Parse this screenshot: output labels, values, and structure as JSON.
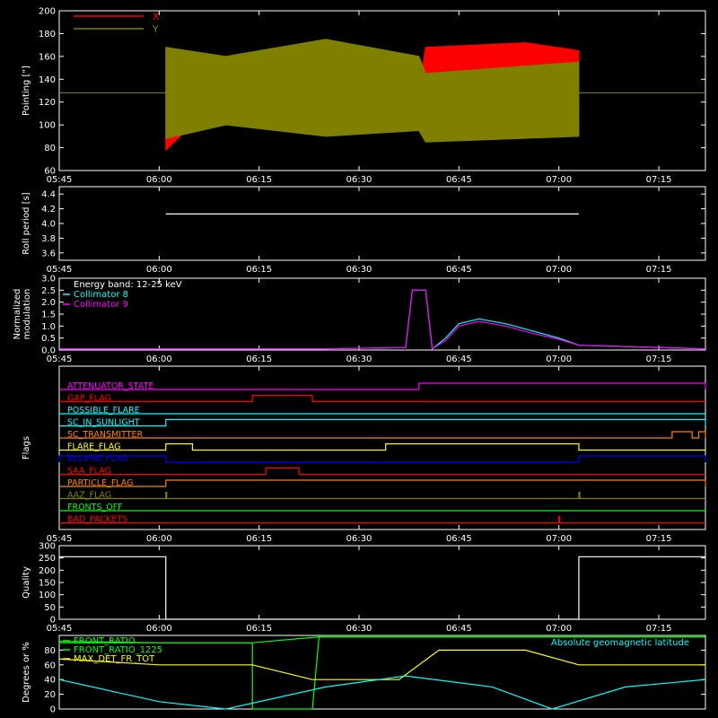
{
  "chart_data": [
    {
      "type": "line",
      "ylabel": "Pointing [\"]",
      "xlim": [
        "05:45",
        "07:22"
      ],
      "ylim": [
        60,
        200
      ],
      "yticks": [
        60,
        80,
        100,
        120,
        140,
        160,
        180,
        200
      ],
      "xticks": [
        "05:45",
        "06:00",
        "06:15",
        "06:30",
        "06:45",
        "07:00",
        "07:15"
      ],
      "legend_position": "top-left",
      "series": [
        {
          "name": "X",
          "color": "#ff0000",
          "envelope": [
            {
              "t": "06:01",
              "low": 78,
              "high": 165
            },
            {
              "t": "06:05",
              "low": 100,
              "high": 150
            },
            {
              "t": "06:15",
              "low": 120,
              "high": 140
            },
            {
              "t": "06:25",
              "low": 125,
              "high": 135
            },
            {
              "t": "06:39",
              "low": 128,
              "high": 132
            },
            {
              "t": "06:40",
              "low": 118,
              "high": 168
            },
            {
              "t": "06:55",
              "low": 112,
              "high": 172
            },
            {
              "t": "07:03",
              "low": 118,
              "high": 165
            }
          ]
        },
        {
          "name": "Y",
          "color": "#808000",
          "baseline": 128,
          "envelope": [
            {
              "t": "06:01",
              "low": 88,
              "high": 168
            },
            {
              "t": "06:10",
              "low": 100,
              "high": 160
            },
            {
              "t": "06:25",
              "low": 90,
              "high": 175
            },
            {
              "t": "06:39",
              "low": 95,
              "high": 160
            },
            {
              "t": "06:40",
              "low": 85,
              "high": 145
            },
            {
              "t": "07:03",
              "low": 90,
              "high": 155
            }
          ]
        }
      ]
    },
    {
      "type": "line",
      "ylabel": "Roll period [s]",
      "xlim": [
        "05:45",
        "07:22"
      ],
      "ylim": [
        3.5,
        4.5
      ],
      "yticks": [
        3.6,
        3.8,
        4.0,
        4.2,
        4.4
      ],
      "xticks": [
        "05:45",
        "06:00",
        "06:15",
        "06:30",
        "06:45",
        "07:00",
        "07:15"
      ],
      "series": [
        {
          "name": "",
          "color": "#ffffff",
          "points": [
            [
              "06:01",
              4.13
            ],
            [
              "07:03",
              4.13
            ]
          ]
        }
      ]
    },
    {
      "type": "line",
      "ylabel": "Normalized modulation",
      "xlim": [
        "05:45",
        "07:22"
      ],
      "ylim": [
        0,
        3
      ],
      "yticks": [
        0.0,
        0.5,
        1.0,
        1.5,
        2.0,
        2.5,
        3.0
      ],
      "xticks": [
        "05:45",
        "06:00",
        "06:15",
        "06:30",
        "06:45",
        "07:00",
        "07:15"
      ],
      "legend_title": "Energy band: 12-25 keV",
      "series": [
        {
          "name": "Collimator 8",
          "color": "#00ffff",
          "points": [
            [
              "05:45",
              0.05
            ],
            [
              "06:14",
              0.05
            ],
            [
              "06:24",
              0.05
            ],
            [
              "06:37",
              0.1
            ],
            [
              "06:38",
              2.5
            ],
            [
              "06:40",
              2.5
            ],
            [
              "06:41",
              0.05
            ],
            [
              "06:43",
              0.5
            ],
            [
              "06:45",
              1.1
            ],
            [
              "06:48",
              1.3
            ],
            [
              "06:52",
              1.1
            ],
            [
              "06:56",
              0.8
            ],
            [
              "07:00",
              0.5
            ],
            [
              "07:03",
              0.2
            ],
            [
              "07:22",
              0.05
            ]
          ]
        },
        {
          "name": "Collimator 9",
          "color": "#ff00ff",
          "points": [
            [
              "05:45",
              0.05
            ],
            [
              "06:14",
              0.05
            ],
            [
              "06:24",
              0.05
            ],
            [
              "06:37",
              0.1
            ],
            [
              "06:38",
              2.5
            ],
            [
              "06:40",
              2.5
            ],
            [
              "06:41",
              0.05
            ],
            [
              "06:43",
              0.4
            ],
            [
              "06:45",
              1.0
            ],
            [
              "06:48",
              1.2
            ],
            [
              "06:52",
              1.0
            ],
            [
              "06:56",
              0.7
            ],
            [
              "07:00",
              0.45
            ],
            [
              "07:03",
              0.2
            ],
            [
              "07:22",
              0.05
            ]
          ]
        }
      ]
    },
    {
      "type": "line",
      "ylabel": "Flags",
      "xlim": [
        "05:45",
        "07:22"
      ],
      "xticks": [
        "05:45",
        "06:00",
        "06:15",
        "06:30",
        "06:45",
        "07:00",
        "07:15"
      ],
      "flags": [
        {
          "name": "ATTENUATOR_STATE",
          "color": "#ff00ff",
          "on": [
            [
              "06:39",
              "07:22"
            ]
          ]
        },
        {
          "name": "GAP_FLAG",
          "color": "#ff0000",
          "on": [
            [
              "06:14",
              "06:23"
            ]
          ]
        },
        {
          "name": "POSSIBLE_FLARE",
          "color": "#00ffff",
          "on": []
        },
        {
          "name": "SC_IN_SUNLIGHT",
          "color": "#00ffff",
          "on": [
            [
              "06:01",
              "07:22"
            ]
          ]
        },
        {
          "name": "SC_TRANSMITTER",
          "color": "#ff8000",
          "on": [
            [
              "07:17",
              "07:20"
            ],
            [
              "07:21",
              "07:22"
            ]
          ]
        },
        {
          "name": "FLARE_FLAG",
          "color": "#ffff00",
          "on": [
            [
              "06:01",
              "06:05"
            ],
            [
              "06:34",
              "07:03"
            ]
          ]
        },
        {
          "name": "ECLIPSE_FLAG",
          "color": "#0000ff",
          "on": [
            [
              "05:45",
              "06:01"
            ],
            [
              "07:03",
              "07:22"
            ]
          ]
        },
        {
          "name": "SAA_FLAG",
          "color": "#ff0000",
          "on": [
            [
              "06:16",
              "06:21"
            ]
          ]
        },
        {
          "name": "PARTICLE_FLAG",
          "color": "#ff8000",
          "on": [
            [
              "06:01",
              "07:22"
            ]
          ]
        },
        {
          "name": "AAZ_FLAG",
          "color": "#808000",
          "on": [
            [
              "06:01",
              "06:01"
            ],
            [
              "07:03",
              "07:03"
            ]
          ]
        },
        {
          "name": "FRONTS_OFF",
          "color": "#00ff00",
          "on": []
        },
        {
          "name": "BAD_PACKETS",
          "color": "#ff0000",
          "on": [
            [
              "07:00",
              "07:00"
            ]
          ]
        }
      ]
    },
    {
      "type": "line",
      "ylabel": "Quality",
      "xlim": [
        "05:45",
        "07:22"
      ],
      "ylim": [
        0,
        300
      ],
      "yticks": [
        0,
        50,
        100,
        150,
        200,
        250,
        300
      ],
      "xticks": [
        "05:45",
        "06:00",
        "06:15",
        "06:30",
        "06:45",
        "07:00",
        "07:15"
      ],
      "series": [
        {
          "name": "",
          "color": "#ffffff",
          "points": [
            [
              "05:45",
              255
            ],
            [
              "06:01",
              255
            ],
            [
              "06:01",
              0
            ],
            [
              "07:03",
              0
            ],
            [
              "07:03",
              255
            ],
            [
              "07:22",
              255
            ]
          ]
        }
      ]
    },
    {
      "type": "line",
      "ylabel": "Degrees or %",
      "xlim": [
        "05:45",
        "07:22"
      ],
      "ylim": [
        0,
        100
      ],
      "yticks": [
        0,
        20,
        40,
        60,
        80
      ],
      "legend_position": "top-left",
      "series": [
        {
          "name": "FRONT_RATIO",
          "color": "#00ff00",
          "points": [
            [
              "05:45",
              90
            ],
            [
              "06:14",
              90
            ],
            [
              "06:14",
              0
            ],
            [
              "06:23",
              0
            ],
            [
              "06:24",
              98
            ],
            [
              "06:40",
              98
            ],
            [
              "07:22",
              98
            ]
          ]
        },
        {
          "name": "FRONT_RATIO_1225",
          "color": "#00ff00",
          "points": [
            [
              "05:45",
              92
            ],
            [
              "06:00",
              90
            ],
            [
              "06:14",
              90
            ],
            [
              "06:24",
              98
            ],
            [
              "07:22",
              98
            ]
          ]
        },
        {
          "name": "MAX_DET_FR_TOT",
          "color": "#ffff00",
          "points": [
            [
              "05:45",
              68
            ],
            [
              "06:00",
              60
            ],
            [
              "06:14",
              60
            ],
            [
              "06:23",
              40
            ],
            [
              "06:36",
              40
            ],
            [
              "06:42",
              80
            ],
            [
              "06:55",
              80
            ],
            [
              "07:03",
              60
            ],
            [
              "07:22",
              60
            ]
          ]
        },
        {
          "name": "Absolute geomagnetic latitude",
          "color": "#00ffff",
          "points": [
            [
              "05:45",
              40
            ],
            [
              "06:00",
              10
            ],
            [
              "06:10",
              0
            ],
            [
              "06:25",
              30
            ],
            [
              "06:37",
              45
            ],
            [
              "06:50",
              30
            ],
            [
              "06:59",
              0
            ],
            [
              "07:10",
              30
            ],
            [
              "07:22",
              40
            ]
          ]
        }
      ]
    }
  ]
}
